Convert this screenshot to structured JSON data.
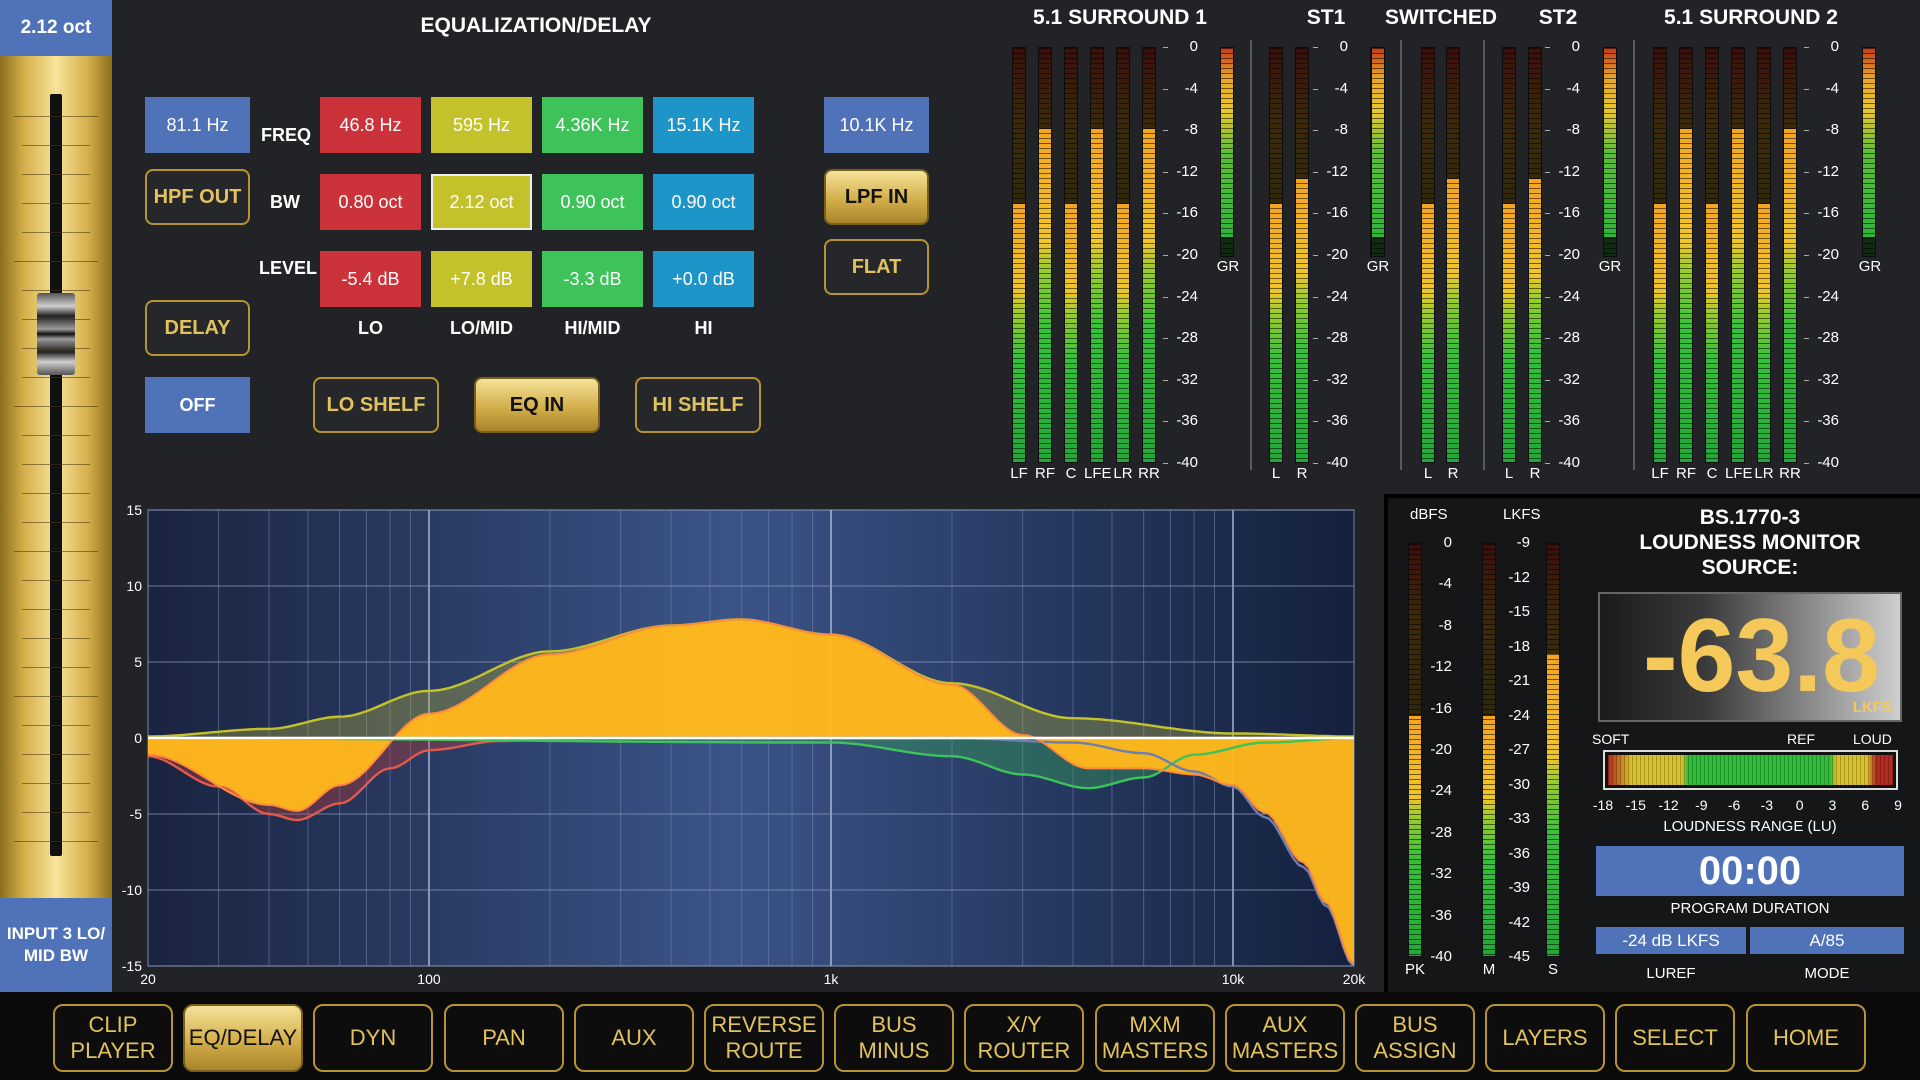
{
  "fader": {
    "top_label": "2.12 oct",
    "bottom_label": "INPUT 3 LO/ MID BW"
  },
  "eq": {
    "title": "EQUALIZATION/DELAY",
    "hpf_freq": "81.1 Hz",
    "hpf_button": "HPF OUT",
    "delay_button": "DELAY",
    "delay_state": "OFF",
    "row_labels": {
      "freq": "FREQ",
      "bw": "BW",
      "level": "LEVEL"
    },
    "bands": [
      {
        "name": "LO",
        "freq": "46.8 Hz",
        "bw": "0.80 oct",
        "level": "-5.4 dB",
        "color": "#cc3239"
      },
      {
        "name": "LO/MID",
        "freq": "595  Hz",
        "bw": "2.12 oct",
        "level": "+7.8 dB",
        "color": "#c4c22a"
      },
      {
        "name": "HI/MID",
        "freq": "4.36K Hz",
        "bw": "0.90 oct",
        "level": "-3.3 dB",
        "color": "#3ec25a"
      },
      {
        "name": "HI",
        "freq": "15.1K Hz",
        "bw": "0.90 oct",
        "level": "+0.0 dB",
        "color": "#1e95c8"
      }
    ],
    "lpf_freq": "10.1K Hz",
    "lpf_button": "LPF IN",
    "flat_button": "FLAT",
    "lo_shelf_button": "LO SHELF",
    "eq_in_button": "EQ IN",
    "hi_shelf_button": "HI SHELF"
  },
  "meters": {
    "groups": [
      {
        "title": "5.1 SURROUND 1",
        "channels": [
          "LF",
          "RF",
          "C",
          "LFE",
          "LR",
          "RR"
        ],
        "levels": [
          0.62,
          0.8,
          0.62,
          0.8,
          0.62,
          0.8
        ],
        "gr": 0.9
      },
      {
        "title": "ST1",
        "channels": [
          "L",
          "R"
        ],
        "levels": [
          0.62,
          0.68
        ],
        "gr": 0.9
      },
      {
        "title": "SWITCHED",
        "channels": [
          "L",
          "R"
        ],
        "levels": [
          0.62,
          0.68
        ],
        "gr": null
      },
      {
        "title": "ST2",
        "channels": [
          "L",
          "R"
        ],
        "levels": [
          0.62,
          0.68
        ],
        "gr": 0.9
      },
      {
        "title": "5.1 SURROUND 2",
        "channels": [
          "LF",
          "RF",
          "C",
          "LFE",
          "LR",
          "RR"
        ],
        "levels": [
          0.62,
          0.8,
          0.62,
          0.8,
          0.62,
          0.8
        ],
        "gr": 0.9
      }
    ],
    "scale": [
      "0",
      "-4",
      "-8",
      "-12",
      "-16",
      "-20",
      "-24",
      "-28",
      "-32",
      "-36",
      "-40"
    ],
    "gr_label": "GR"
  },
  "loudness": {
    "title_lines": [
      "BS.1770-3",
      "LOUDNESS MONITOR",
      "SOURCE:"
    ],
    "dbfs_label": "dBFS",
    "lkfs_label": "LKFS",
    "dbfs_scale": [
      "0",
      "-4",
      "-8",
      "-12",
      "-16",
      "-20",
      "-24",
      "-28",
      "-32",
      "-36",
      "-40"
    ],
    "lkfs_scale": [
      "-9",
      "-12",
      "-15",
      "-18",
      "-21",
      "-24",
      "-27",
      "-30",
      "-33",
      "-36",
      "-39",
      "-42",
      "-45"
    ],
    "pk_label": "PK",
    "m_label": "M",
    "s_label": "S",
    "pk_level": 0.58,
    "m_level": 0.58,
    "s_level": 0.73,
    "value": "-63.8",
    "unit": "LKFS",
    "soft": "SOFT",
    "ref": "REF",
    "loud": "LOUD",
    "range_scale": [
      "-18",
      "-15",
      "-12",
      "-9",
      "-6",
      "-3",
      "0",
      "3",
      "6",
      "9"
    ],
    "range_label": "LOUDNESS RANGE (LU)",
    "duration": "00:00",
    "duration_label": "PROGRAM DURATION",
    "luref": "-24 dB LKFS",
    "mode": "A/85",
    "luref_label": "LUREF",
    "mode_label": "MODE"
  },
  "graph": {
    "y_ticks": [
      "15",
      "10",
      "5",
      "0",
      "-5",
      "-10",
      "-15"
    ],
    "x_ticks": [
      "20",
      "100",
      "1k",
      "10k",
      "20k"
    ]
  },
  "chart_data": {
    "type": "line",
    "x_scale": "log",
    "xlim": [
      20,
      20000
    ],
    "ylim": [
      -15,
      15
    ],
    "xlabel": "",
    "ylabel": "",
    "x_ticks": [
      20,
      100,
      1000,
      10000,
      20000
    ],
    "y_ticks": [
      15,
      10,
      5,
      0,
      -5,
      -10,
      -15
    ],
    "series": [
      {
        "color": "#e25a4c",
        "x": [
          20,
          30,
          40,
          47,
          60,
          80,
          100,
          150,
          200,
          300,
          500,
          1000,
          2000,
          5000,
          10000,
          20000
        ],
        "y": [
          -1.2,
          -3.2,
          -5.0,
          -5.4,
          -4.3,
          -2.0,
          -0.8,
          -0.2,
          0,
          0,
          0,
          0,
          0,
          0,
          0,
          0
        ]
      },
      {
        "color": "#c4c22a",
        "x": [
          20,
          40,
          60,
          100,
          200,
          400,
          595,
          1000,
          2000,
          4000,
          10000,
          20000
        ],
        "y": [
          0.1,
          0.6,
          1.4,
          3.1,
          5.7,
          7.4,
          7.8,
          6.8,
          3.6,
          1.3,
          0.3,
          0.1
        ]
      },
      {
        "color": "#3ec25a",
        "x": [
          20,
          1000,
          2000,
          3000,
          4360,
          6000,
          8000,
          12000,
          20000
        ],
        "y": [
          0,
          -0.3,
          -1.2,
          -2.4,
          -3.3,
          -2.6,
          -1.1,
          -0.3,
          0
        ]
      },
      {
        "color": "#6c7fb0",
        "x": [
          20,
          2000,
          4000,
          6000,
          8000,
          10000,
          12000,
          15000,
          17000,
          20000
        ],
        "y": [
          0,
          0,
          -0.3,
          -1.0,
          -2.2,
          -3.2,
          -5.2,
          -8.5,
          -11.0,
          -15.0
        ]
      },
      {
        "color": "#ff8a3c",
        "x": [
          20,
          40,
          47,
          60,
          100,
          200,
          400,
          595,
          1000,
          2000,
          3000,
          4360,
          6000,
          8000,
          10000,
          12000,
          15000,
          17000,
          20000
        ],
        "y": [
          -1.1,
          -4.4,
          -4.8,
          -3.1,
          1.6,
          5.5,
          7.4,
          7.8,
          6.8,
          3.5,
          0.2,
          -2.0,
          -2.0,
          -2.4,
          -3.1,
          -4.9,
          -8.2,
          -10.8,
          -14.9
        ]
      }
    ]
  },
  "nav": [
    {
      "label": "CLIP PLAYER",
      "active": false
    },
    {
      "label": "EQ/DELAY",
      "active": true
    },
    {
      "label": "DYN",
      "active": false
    },
    {
      "label": "PAN",
      "active": false
    },
    {
      "label": "AUX",
      "active": false
    },
    {
      "label": "REVERSE ROUTE",
      "active": false
    },
    {
      "label": "BUS MINUS",
      "active": false
    },
    {
      "label": "X/Y ROUTER",
      "active": false
    },
    {
      "label": "MXM MASTERS",
      "active": false
    },
    {
      "label": "AUX MASTERS",
      "active": false
    },
    {
      "label": "BUS ASSIGN",
      "active": false
    },
    {
      "label": "LAYERS",
      "active": false
    },
    {
      "label": "SELECT",
      "active": false
    },
    {
      "label": "HOME",
      "active": false
    }
  ]
}
